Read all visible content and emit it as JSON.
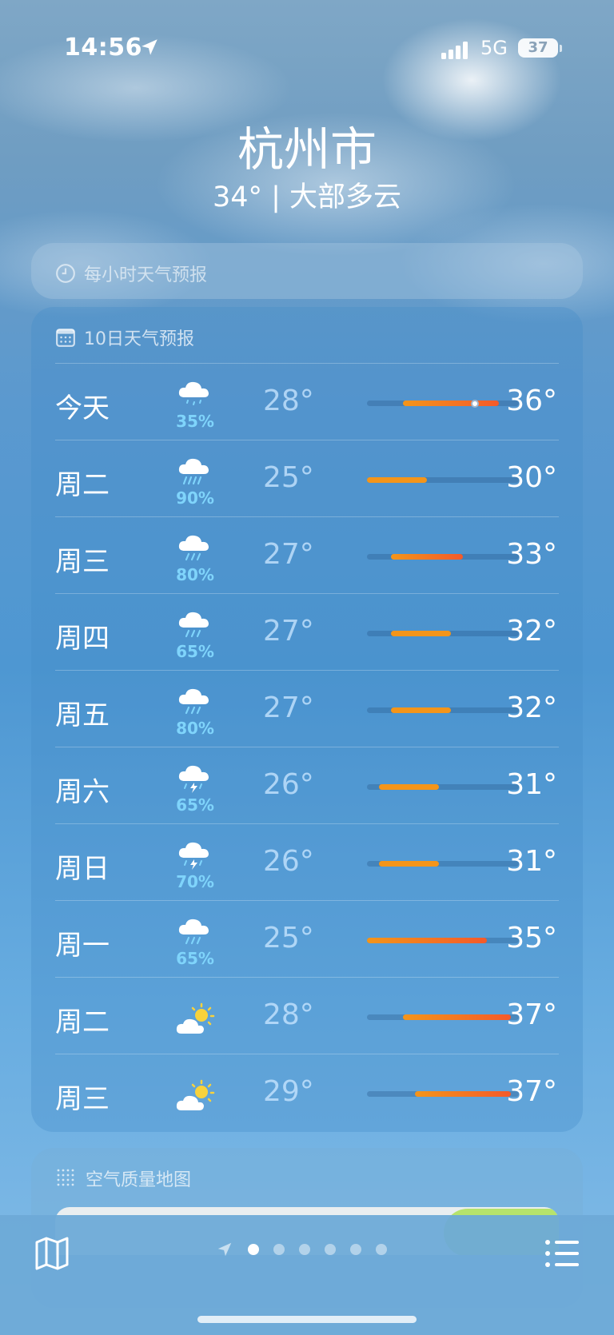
{
  "status_bar": {
    "time": "14:56",
    "network": "5G",
    "battery": "37"
  },
  "header": {
    "city": "杭州市",
    "summary": "34° | 大部多云"
  },
  "hourly": {
    "title": "每小时天气预报"
  },
  "ten_day": {
    "title": "10日天气预报",
    "rows": [
      {
        "day": "今天",
        "icon": "cloud-drizzle-icon",
        "precip": "35%",
        "low": "28°",
        "high": "36°",
        "current_temp": 34
      },
      {
        "day": "周二",
        "icon": "cloud-heavy-rain-icon",
        "precip": "90%",
        "low": "25°",
        "high": "30°"
      },
      {
        "day": "周三",
        "icon": "cloud-rain-icon",
        "precip": "80%",
        "low": "27°",
        "high": "33°"
      },
      {
        "day": "周四",
        "icon": "cloud-rain-icon",
        "precip": "65%",
        "low": "27°",
        "high": "32°"
      },
      {
        "day": "周五",
        "icon": "cloud-rain-icon",
        "precip": "80%",
        "low": "27°",
        "high": "32°"
      },
      {
        "day": "周六",
        "icon": "cloud-thunderstorm-icon",
        "precip": "65%",
        "low": "26°",
        "high": "31°"
      },
      {
        "day": "周日",
        "icon": "cloud-thunderstorm-icon",
        "precip": "70%",
        "low": "26°",
        "high": "31°"
      },
      {
        "day": "周一",
        "icon": "cloud-rain-icon",
        "precip": "65%",
        "low": "25°",
        "high": "35°"
      },
      {
        "day": "周二",
        "icon": "partly-sunny-icon",
        "precip": "",
        "low": "28°",
        "high": "37°"
      },
      {
        "day": "周三",
        "icon": "partly-sunny-icon",
        "precip": "",
        "low": "29°",
        "high": "37°"
      }
    ]
  },
  "air_quality": {
    "title": "空气质量地图"
  },
  "pager": {
    "count": 6,
    "active": 0
  },
  "colors": {
    "bar_orange": "#f4951a",
    "bar_red": "#f45a2a",
    "precip_blue": "#7fd4fb"
  }
}
